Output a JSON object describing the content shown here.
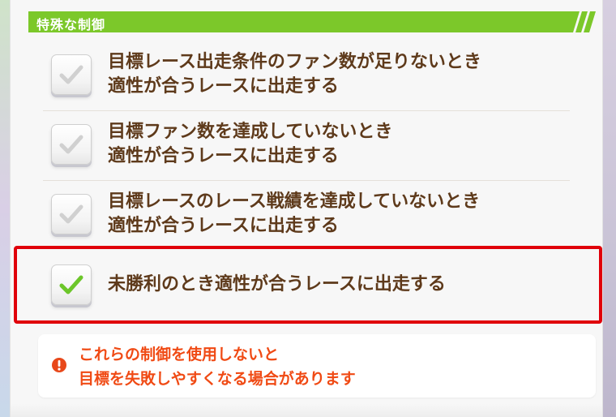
{
  "section": {
    "title": "特殊な制御"
  },
  "options": [
    {
      "line1": "目標レース出走条件のファン数が足りないとき",
      "line2": "適性が合うレースに出走する",
      "checked": false
    },
    {
      "line1": "目標ファン数を達成していないとき",
      "line2": "適性が合うレースに出走する",
      "checked": false
    },
    {
      "line1": "目標レースのレース戦績を達成していないとき",
      "line2": "適性が合うレースに出走する",
      "checked": false
    },
    {
      "line1": "未勝利のとき適性が合うレースに出走する",
      "checked": true
    }
  ],
  "warning": {
    "line1": "これらの制御を使用しないと",
    "line2": "目標を失敗しやすくなる場合があります",
    "icon": "exclamation-icon"
  },
  "colors": {
    "header_green": "#7cc82a",
    "text_brown": "#5e3a1b",
    "check_gray": "#d0d0d0",
    "check_green": "#6cc62a",
    "highlight_red": "#e0000a",
    "warning_orange": "#f04a14"
  }
}
